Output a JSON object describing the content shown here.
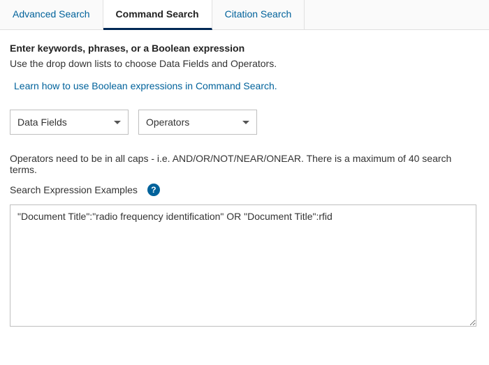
{
  "tabs": {
    "advanced": "Advanced Search",
    "command": "Command Search",
    "citation": "Citation Search"
  },
  "content": {
    "title": "Enter keywords, phrases, or a Boolean expression",
    "subtitle": "Use the drop down lists to choose Data Fields and Operators.",
    "learn_link": "Learn how to use Boolean expressions in Command Search.",
    "dropdowns": {
      "data_fields": "Data Fields",
      "operators": "Operators"
    },
    "operators_note": "Operators need to be in all caps - i.e. AND/OR/NOT/NEAR/ONEAR. There is a maximum of 40 search terms.",
    "examples_label": "Search Expression Examples",
    "help_symbol": "?",
    "search_expression": "\"Document Title\":\"radio frequency identification\" OR \"Document Title\":rfid"
  }
}
